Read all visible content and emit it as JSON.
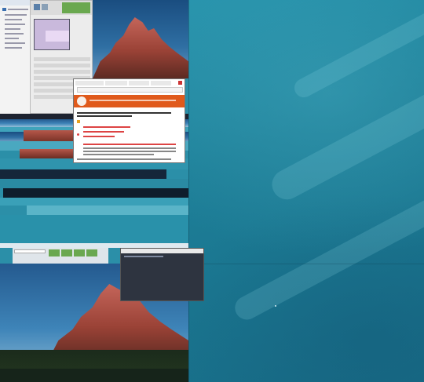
{
  "desktop": {
    "wallpaper_colors": [
      "#2a9ab3",
      "#1d7f98",
      "#176b86"
    ],
    "accent": "#2b8fa8"
  },
  "file_manager": {
    "title": "",
    "items": []
  },
  "settings_window": {
    "tab_color": "#6aa84f",
    "preview_color": "#c9b9dc"
  },
  "browser": {
    "tabs": [],
    "url": "",
    "header_color": "#e05a1c"
  },
  "taskbar": {
    "color": "#1d2330"
  },
  "terminal": {
    "background": "#2e3440"
  },
  "icons": [
    "folder-icon",
    "browser-icon",
    "terminal-icon",
    "cursor-icon"
  ]
}
